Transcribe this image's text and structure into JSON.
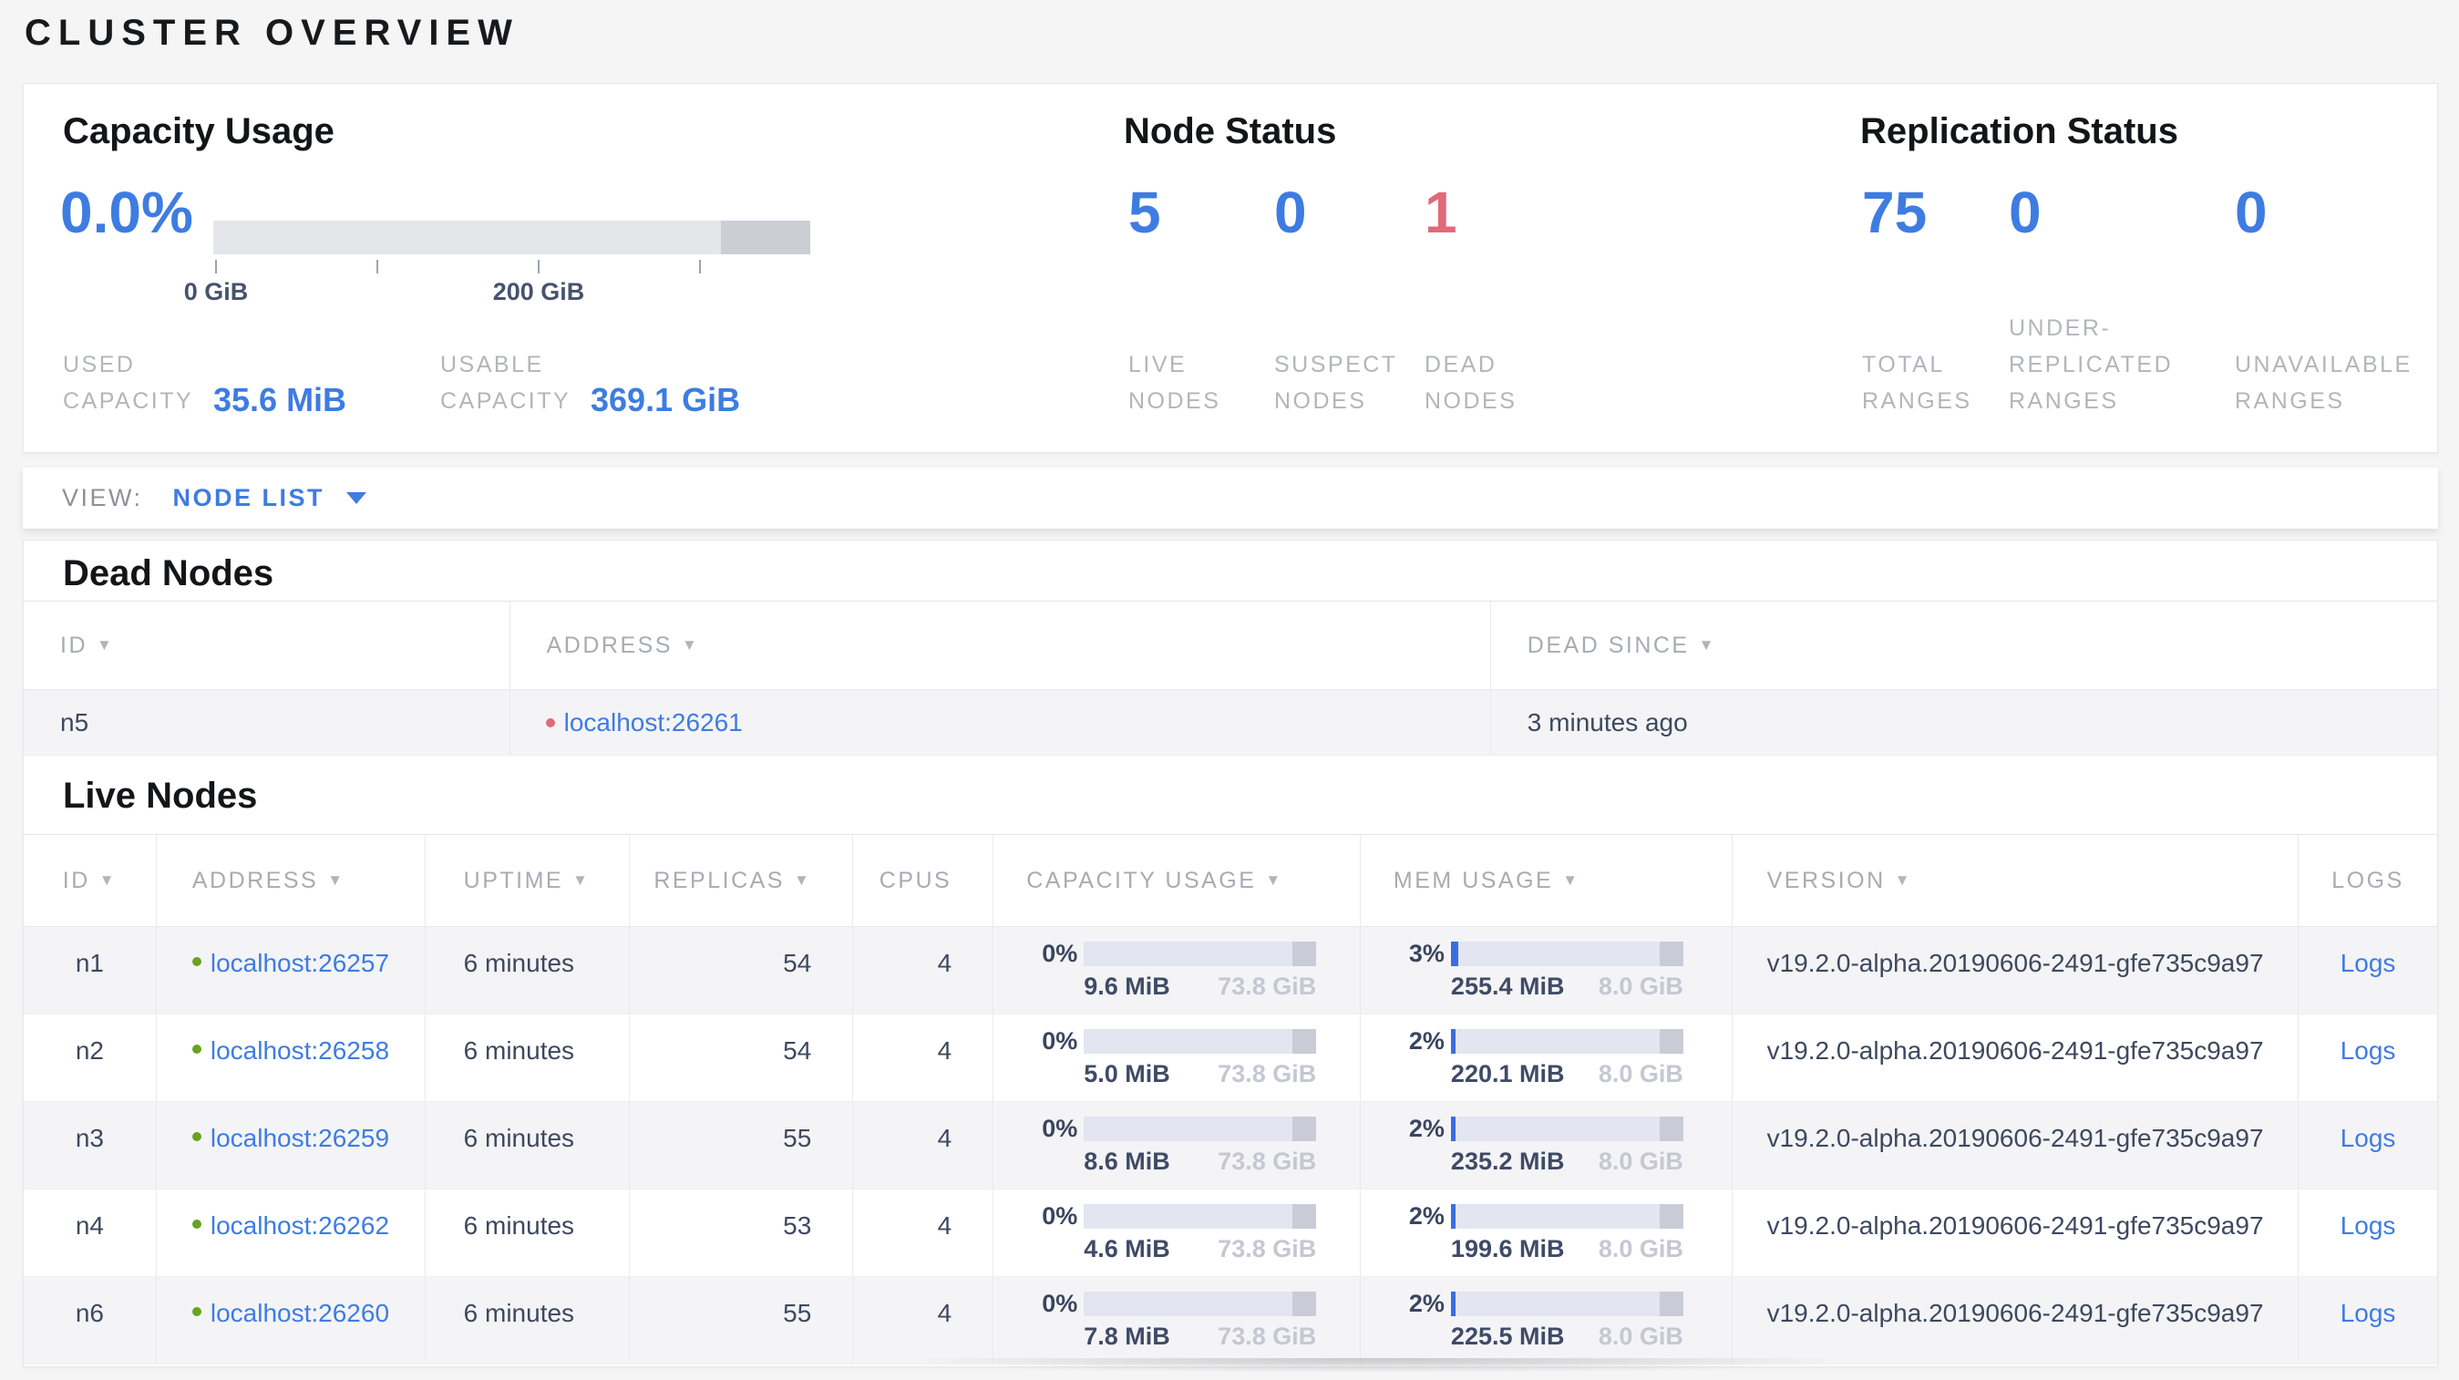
{
  "title": "CLUSTER OVERVIEW",
  "colors": {
    "accent_blue": "#3e7ce2",
    "danger_red": "#e16a78",
    "live_green": "#68a31e",
    "bar_track": "#e3e5f0",
    "bar_dark_segment": "#c9ccd6"
  },
  "icons": {
    "sort_arrow": "▼"
  },
  "summary": {
    "capacity": {
      "heading": "Capacity Usage",
      "percent": "0.0%",
      "ticks": [
        "0 GiB",
        "",
        "200 GiB",
        ""
      ],
      "used_label": "USED\nCAPACITY",
      "used_value": "35.6 MiB",
      "usable_label": "USABLE\nCAPACITY",
      "usable_value": "369.1 GiB"
    },
    "nodes": {
      "heading": "Node Status",
      "stats": [
        {
          "value": "5",
          "label": "LIVE\nNODES"
        },
        {
          "value": "0",
          "label": "SUSPECT\nNODES"
        },
        {
          "value": "1",
          "label": "DEAD\nNODES"
        }
      ]
    },
    "replication": {
      "heading": "Replication Status",
      "stats": [
        {
          "value": "75",
          "label": "TOTAL\nRANGES"
        },
        {
          "value": "0",
          "label": "UNDER-\nREPLICATED\nRANGES"
        },
        {
          "value": "0",
          "label": "UNAVAILABLE\nRANGES"
        }
      ]
    }
  },
  "view_bar": {
    "label": "VIEW:",
    "selected": "NODE LIST"
  },
  "dead_nodes": {
    "heading": "Dead Nodes",
    "columns": {
      "id": "ID",
      "address": "ADDRESS",
      "dead_since": "DEAD SINCE"
    },
    "rows": [
      {
        "id": "n5",
        "address": "localhost:26261",
        "dead_since": "3 minutes ago"
      }
    ]
  },
  "live_nodes": {
    "heading": "Live Nodes",
    "columns": {
      "id": "ID",
      "address": "ADDRESS",
      "uptime": "UPTIME",
      "replicas": "REPLICAS",
      "cpus": "CPUS",
      "capacity": "CAPACITY USAGE",
      "mem": "MEM USAGE",
      "version": "VERSION",
      "logs": "LOGS"
    },
    "logs_label": "Logs",
    "rows": [
      {
        "id": "n1",
        "address": "localhost:26257",
        "uptime": "6 minutes",
        "replicas": "54",
        "cpus": "4",
        "capacity": {
          "percent": "0%",
          "fill": "0%",
          "used": "9.6 MiB",
          "total": "73.8 GiB"
        },
        "mem": {
          "percent": "3%",
          "fill": "3%",
          "used": "255.4 MiB",
          "total": "8.0 GiB"
        },
        "version": "v19.2.0-alpha.20190606-2491-gfe735c9a97"
      },
      {
        "id": "n2",
        "address": "localhost:26258",
        "uptime": "6 minutes",
        "replicas": "54",
        "cpus": "4",
        "capacity": {
          "percent": "0%",
          "fill": "0%",
          "used": "5.0 MiB",
          "total": "73.8 GiB"
        },
        "mem": {
          "percent": "2%",
          "fill": "2%",
          "used": "220.1 MiB",
          "total": "8.0 GiB"
        },
        "version": "v19.2.0-alpha.20190606-2491-gfe735c9a97"
      },
      {
        "id": "n3",
        "address": "localhost:26259",
        "uptime": "6 minutes",
        "replicas": "55",
        "cpus": "4",
        "capacity": {
          "percent": "0%",
          "fill": "0%",
          "used": "8.6 MiB",
          "total": "73.8 GiB"
        },
        "mem": {
          "percent": "2%",
          "fill": "2%",
          "used": "235.2 MiB",
          "total": "8.0 GiB"
        },
        "version": "v19.2.0-alpha.20190606-2491-gfe735c9a97"
      },
      {
        "id": "n4",
        "address": "localhost:26262",
        "uptime": "6 minutes",
        "replicas": "53",
        "cpus": "4",
        "capacity": {
          "percent": "0%",
          "fill": "0%",
          "used": "4.6 MiB",
          "total": "73.8 GiB"
        },
        "mem": {
          "percent": "2%",
          "fill": "2%",
          "used": "199.6 MiB",
          "total": "8.0 GiB"
        },
        "version": "v19.2.0-alpha.20190606-2491-gfe735c9a97"
      },
      {
        "id": "n6",
        "address": "localhost:26260",
        "uptime": "6 minutes",
        "replicas": "55",
        "cpus": "4",
        "capacity": {
          "percent": "0%",
          "fill": "0%",
          "used": "7.8 MiB",
          "total": "73.8 GiB"
        },
        "mem": {
          "percent": "2%",
          "fill": "2%",
          "used": "225.5 MiB",
          "total": "8.0 GiB"
        },
        "version": "v19.2.0-alpha.20190606-2491-gfe735c9a97"
      }
    ]
  }
}
